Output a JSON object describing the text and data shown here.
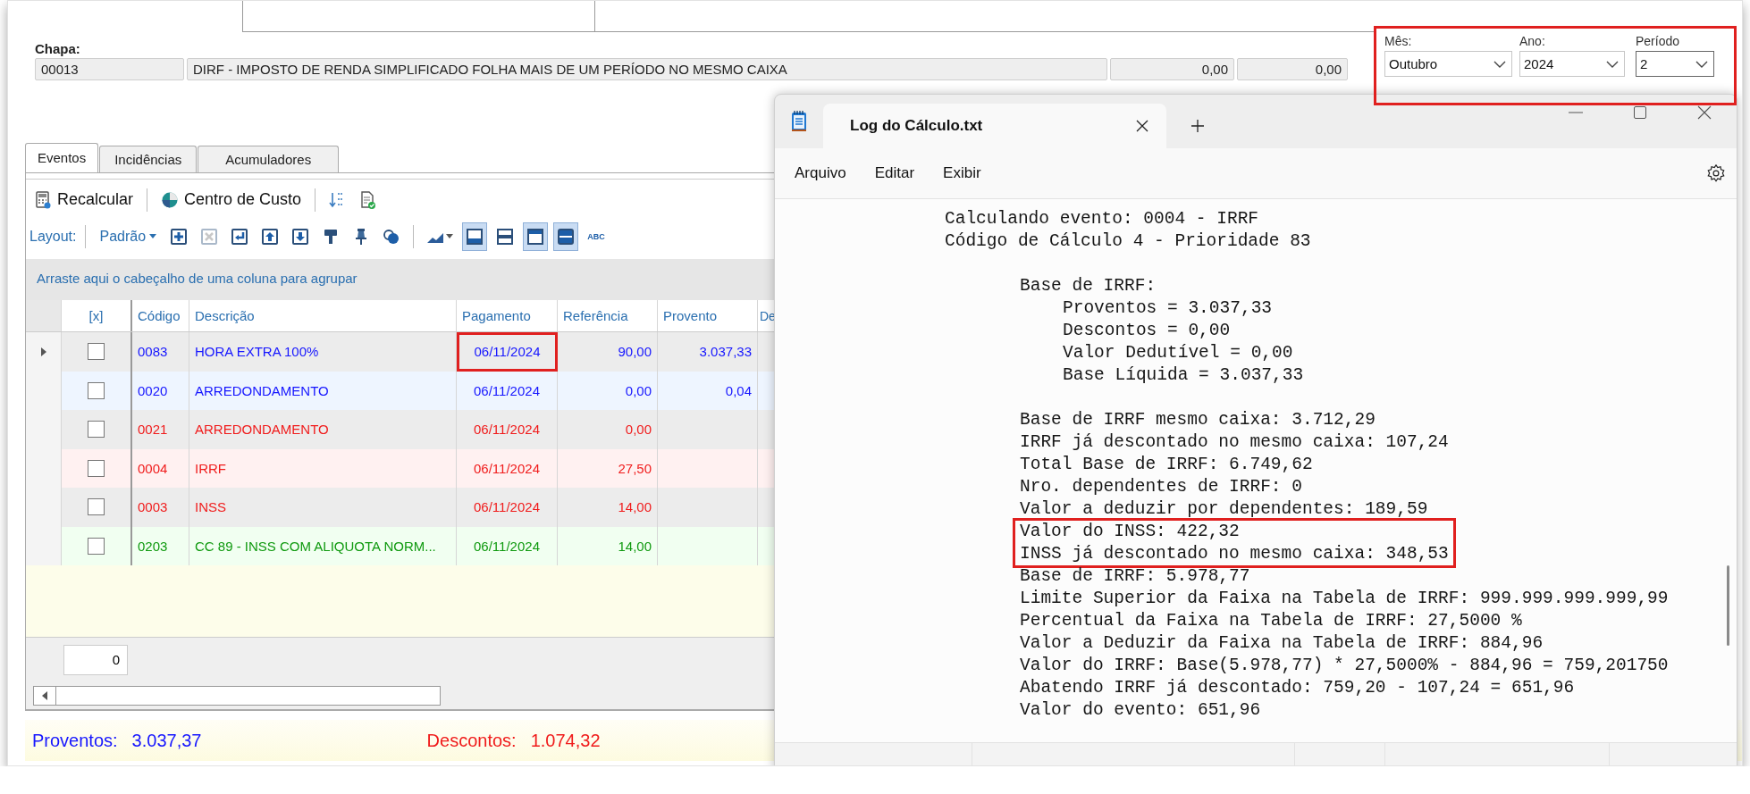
{
  "chapa": {
    "label": "Chapa:",
    "code": "00013",
    "description": "DIRF - IMPOSTO DE RENDA SIMPLIFICADO FOLHA MAIS DE UM PERÍODO NO MESMO CAIXA",
    "value_1": "0,00",
    "value_2": "0,00"
  },
  "period": {
    "highlighted": true,
    "fields": [
      {
        "label": "Mês:",
        "value": "Outubro",
        "focused": false
      },
      {
        "label": "Ano:",
        "value": "2024",
        "focused": false
      },
      {
        "label": "Período",
        "value": "2",
        "focused": true
      }
    ]
  },
  "tabs": [
    {
      "label": "Eventos",
      "selected": true
    },
    {
      "label": "Incidências",
      "selected": false
    },
    {
      "label": "Acumuladores",
      "selected": false
    }
  ],
  "toolbar": [
    {
      "kind": "recalc",
      "label": "Recalcular"
    },
    {
      "kind": "cost-center",
      "label": "Centro de Custo"
    },
    {
      "kind": "sort"
    },
    {
      "kind": "doc-check"
    }
  ],
  "layout_bar": {
    "label": "Layout:",
    "preset": "Padrão",
    "tools": [
      {
        "kind": "add",
        "disabled": false
      },
      {
        "kind": "delete",
        "disabled": true
      },
      {
        "kind": "enter",
        "disabled": false
      },
      {
        "kind": "up",
        "disabled": false
      },
      {
        "kind": "down",
        "disabled": false
      },
      {
        "kind": "brush",
        "disabled": false
      },
      {
        "kind": "pin",
        "disabled": false
      },
      {
        "kind": "shapes",
        "disabled": false
      },
      {
        "kind": "chart",
        "disabled": false
      },
      {
        "kind": "view-bottom",
        "disabled": false,
        "pressed": true
      },
      {
        "kind": "view-middle",
        "disabled": false,
        "pressed": false
      },
      {
        "kind": "view-top",
        "disabled": false,
        "pressed": true
      },
      {
        "kind": "view-split",
        "disabled": false,
        "pressed": true
      },
      {
        "kind": "spell",
        "label": "ABC",
        "disabled": false
      }
    ]
  },
  "grid": {
    "group_hint": "Arraste aqui o cabeçalho de uma coluna para agrupar",
    "columns": [
      "[x]",
      "Código",
      "Descrição",
      "Pagamento",
      "Referência",
      "Provento",
      "De"
    ],
    "rows": [
      {
        "current": true,
        "checked": false,
        "kind": "provento",
        "code": "0083",
        "description": "HORA EXTRA 100%",
        "payment": "06/11/2024",
        "payment_highlighted": true,
        "reference": "90,00",
        "provento": "3.037,33"
      },
      {
        "current": false,
        "checked": false,
        "kind": "provento",
        "code": "0020",
        "description": "ARREDONDAMENTO",
        "payment": "06/11/2024",
        "payment_highlighted": false,
        "reference": "0,00",
        "provento": "0,04"
      },
      {
        "current": false,
        "checked": false,
        "kind": "desconto",
        "code": "0021",
        "description": "ARREDONDAMENTO",
        "payment": "06/11/2024",
        "payment_highlighted": false,
        "reference": "0,00"
      },
      {
        "current": false,
        "checked": false,
        "kind": "desconto",
        "code": "0004",
        "description": "IRRF",
        "payment": "06/11/2024",
        "payment_highlighted": false,
        "reference": "27,50"
      },
      {
        "current": false,
        "checked": false,
        "kind": "desconto",
        "code": "0003",
        "description": "INSS",
        "payment": "06/11/2024",
        "payment_highlighted": false,
        "reference": "14,00"
      },
      {
        "current": false,
        "checked": false,
        "kind": "base",
        "code": "0203",
        "description": "CC 89 - INSS COM ALIQUOTA NORM...",
        "payment": "06/11/2024",
        "payment_highlighted": false,
        "reference": "14,00"
      }
    ],
    "footer_count": "0"
  },
  "totals": [
    {
      "kind": "provento",
      "label": "Proventos:",
      "value": "3.037,37"
    },
    {
      "kind": "desconto",
      "label": "Descontos:",
      "value": "1.074,32"
    }
  ],
  "notepad": {
    "tab_title": "Log do Cálculo.txt",
    "menu": [
      "Arquivo",
      "Editar",
      "Exibir"
    ],
    "log": [
      {
        "text": "Calculando evento: 0004 - IRRF",
        "highlighted": false
      },
      {
        "text": "Código de Cálculo 4 - Prioridade 83",
        "highlighted": false,
        "children": [
          {
            "text": "Base de IRRF:",
            "highlighted": false,
            "children": [
              {
                "text": "Proventos = 3.037,33",
                "highlighted": false
              },
              {
                "text": "Descontos = 0,00",
                "highlighted": false
              },
              {
                "text": "Valor Dedutível = 0,00",
                "highlighted": false
              },
              {
                "text": "Base Líquida = 3.037,33",
                "highlighted": false
              }
            ]
          },
          {
            "text": "Base de IRRF mesmo caixa: 3.712,29",
            "highlighted": false
          },
          {
            "text": "IRRF já descontado no mesmo caixa: 107,24",
            "highlighted": false
          },
          {
            "text": "Total Base de IRRF: 6.749,62",
            "highlighted": false
          },
          {
            "text": "Nro. dependentes de IRRF: 0",
            "highlighted": false
          },
          {
            "text": "Valor a deduzir por dependentes: 189,59",
            "highlighted": false
          },
          {
            "text": "Valor do INSS: 422,32",
            "highlighted": true
          },
          {
            "text": "INSS já descontado no mesmo caixa: 348,53",
            "highlighted": true
          },
          {
            "text": "Base de IRRF: 5.978,77",
            "highlighted": false
          },
          {
            "text": "Limite Superior da Faixa na Tabela de IRRF: 999.999.999.999,99",
            "highlighted": false
          },
          {
            "text": "Percentual da Faixa na Tabela de IRRF: 27,5000 %",
            "highlighted": false
          },
          {
            "text": "Valor a Deduzir da Faixa na Tabela de IRRF: 884,96",
            "highlighted": false
          },
          {
            "text": "Valor do IRRF: Base(5.978,77) * 27,5000% - 884,96 = 759,201750",
            "highlighted": false
          },
          {
            "text": "Abatendo IRRF já descontado: 759,20 - 107,24 = 651,96",
            "highlighted": false
          },
          {
            "text": "Valor do evento: 651,96",
            "highlighted": false
          }
        ]
      }
    ]
  }
}
